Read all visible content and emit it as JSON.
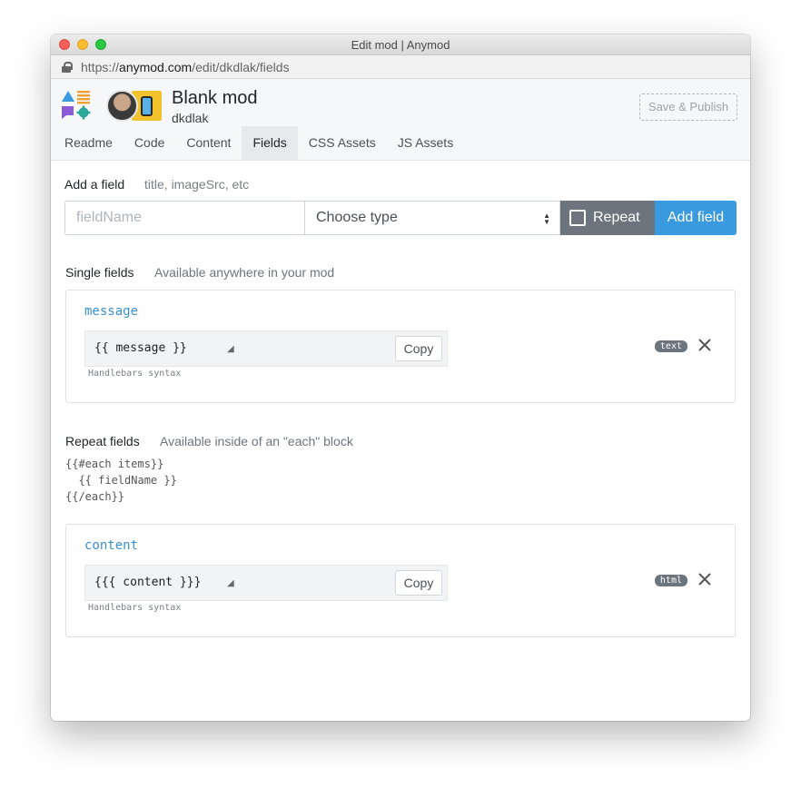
{
  "window": {
    "title": "Edit mod | Anymod"
  },
  "urlbar": {
    "protocol": "https://",
    "host": "anymod.com",
    "path": "/edit/dkdlak/fields"
  },
  "header": {
    "mod_title": "Blank mod",
    "username": "dkdlak",
    "publish_label": "Save & Publish",
    "tabs": [
      {
        "label": "Readme"
      },
      {
        "label": "Code"
      },
      {
        "label": "Content"
      },
      {
        "label": "Fields",
        "active": true
      },
      {
        "label": "CSS Assets"
      },
      {
        "label": "JS Assets"
      }
    ]
  },
  "add_field": {
    "label": "Add a field",
    "hint": "title, imageSrc, etc",
    "name_placeholder": "fieldName",
    "type_value": "Choose type",
    "repeat_label": "Repeat",
    "add_label": "Add field"
  },
  "single": {
    "title": "Single fields",
    "hint": "Available anywhere in your mod",
    "fields": [
      {
        "name": "message",
        "code": "{{ message }}",
        "copy": "Copy",
        "syntax": "Handlebars syntax",
        "type": "text"
      }
    ]
  },
  "repeat": {
    "title": "Repeat fields",
    "hint": "Available inside of an \"each\" block",
    "snippet": "{{#each items}}\n  {{ fieldName }}\n{{/each}}",
    "fields": [
      {
        "name": "content",
        "code": "{{{ content }}}",
        "copy": "Copy",
        "syntax": "Handlebars syntax",
        "type": "html"
      }
    ]
  },
  "colors": {
    "accent": "#3a9ae0",
    "secondary": "#6c757d",
    "field_name": "#3a8fce"
  }
}
